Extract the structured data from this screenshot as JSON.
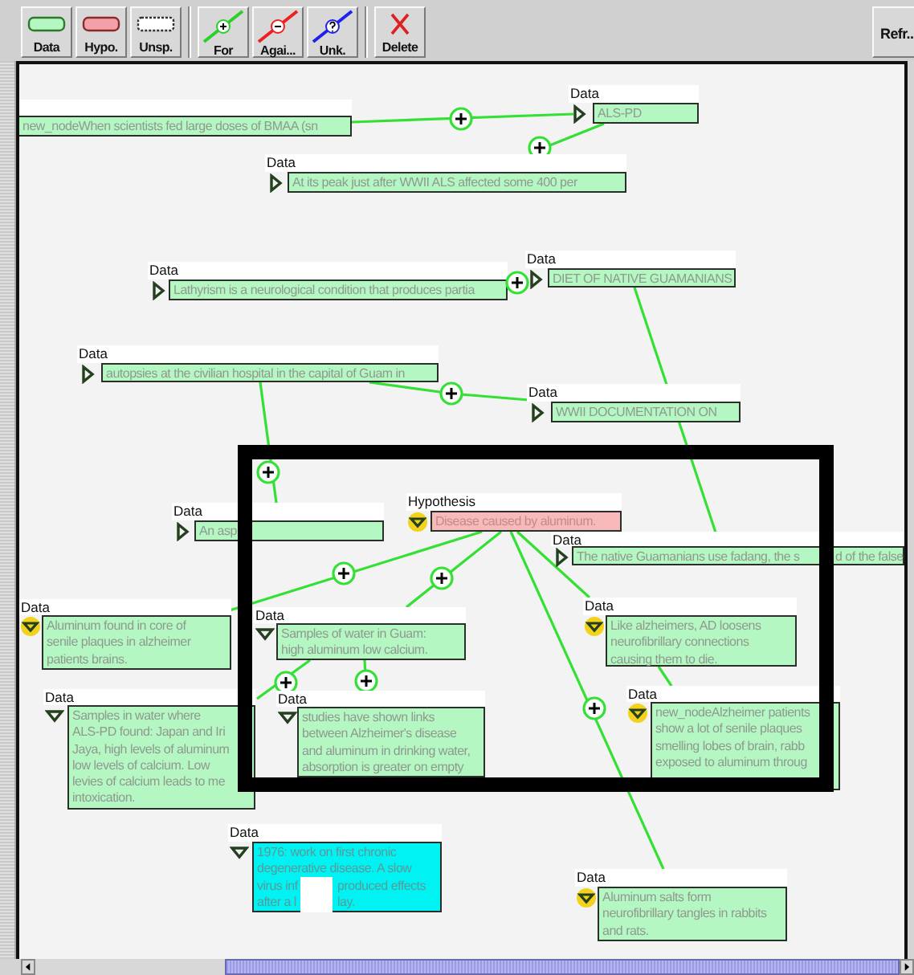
{
  "toolbar": {
    "buttons": [
      {
        "label": "Data",
        "kind": "data"
      },
      {
        "label": "Hypo.",
        "kind": "hypothesis"
      },
      {
        "label": "Unsp.",
        "kind": "unspecified"
      },
      {
        "label": "For",
        "kind": "for"
      },
      {
        "label": "Agai...",
        "kind": "against"
      },
      {
        "label": "Unk.",
        "kind": "unknown"
      },
      {
        "label": "Delete",
        "kind": "delete"
      }
    ],
    "refresh": "Refr.."
  },
  "nodes": [
    {
      "kind": "data",
      "selected": false,
      "lines": [
        "new_nodeWhen scientists fed large doses of BMAA (sn"
      ]
    },
    {
      "label": "Data",
      "kind": "data",
      "selected": false,
      "expanded": false,
      "flagged": false,
      "lines": [
        "ALS-PD"
      ]
    },
    {
      "label": "Data",
      "kind": "data",
      "selected": false,
      "expanded": false,
      "flagged": false,
      "lines": [
        "At its peak just after WWII ALS affected some 400 per"
      ]
    },
    {
      "label": "Data",
      "kind": "data",
      "selected": false,
      "expanded": false,
      "flagged": false,
      "lines": [
        "Lathyrism is a neurological condition that produces partia"
      ]
    },
    {
      "label": "Data",
      "kind": "data",
      "selected": false,
      "expanded": false,
      "flagged": false,
      "lines": [
        "DIET OF NATIVE GUAMANIANS"
      ]
    },
    {
      "label": "Data",
      "kind": "data",
      "selected": false,
      "expanded": false,
      "flagged": false,
      "lines": [
        "autopsies at the civilian hospital in the capital of Guam in"
      ]
    },
    {
      "label": "Data",
      "kind": "data",
      "selected": false,
      "expanded": false,
      "flagged": false,
      "lines": [
        "WWII DOCUMENTATION ON"
      ]
    },
    {
      "label": "Data",
      "kind": "data",
      "selected": false,
      "expanded": false,
      "flagged": false,
      "lines": [
        "An asp"
      ]
    },
    {
      "label": "Hypothesis",
      "kind": "hypothesis",
      "selected": false,
      "expanded": true,
      "flagged": true,
      "lines": [
        "Disease caused by aluminum."
      ]
    },
    {
      "label": "Data",
      "kind": "data",
      "selected": false,
      "expanded": false,
      "flagged": false,
      "lines": [
        [
          "The native Guamanians use fadang, the s",
          "d of the false"
        ]
      ]
    },
    {
      "label": "Data",
      "kind": "data",
      "selected": false,
      "expanded": true,
      "flagged": true,
      "lines": [
        "Aluminum found in core of",
        "senile plaques in alzheimer",
        "patients brains."
      ]
    },
    {
      "label": "Data",
      "kind": "data",
      "selected": false,
      "expanded": true,
      "flagged": false,
      "lines": [
        "Samples of water in Guam:",
        "high aluminum low calcium."
      ]
    },
    {
      "label": "Data",
      "kind": "data",
      "selected": false,
      "expanded": true,
      "flagged": true,
      "lines": [
        "Like alzheimers, AD loosens",
        "neurofibrillary connections",
        "causing them to die."
      ]
    },
    {
      "label": "Data",
      "kind": "data",
      "selected": false,
      "expanded": true,
      "flagged": false,
      "lines": [
        "Samples in water where",
        "ALS-PD found:  Japan and Iri",
        "Jaya, high levels of aluminum",
        "low levels of calcium.  Low",
        "levies of calcium leads to me",
        "intoxication."
      ]
    },
    {
      "label": "Data",
      "kind": "data",
      "selected": false,
      "expanded": true,
      "flagged": false,
      "lines": [
        "studies have shown links",
        "between Alzheimer's disease",
        "and aluminum in drinking water,",
        "absorption is greater on empty"
      ]
    },
    {
      "label": "Data",
      "kind": "data",
      "selected": false,
      "expanded": true,
      "flagged": true,
      "lines": [
        "new_nodeAlzheimer patients",
        "show a lot of senile plaques",
        "smelling lobes of brain, rabb",
        "exposed to aluminum throug"
      ]
    },
    {
      "label": "Data",
      "kind": "data",
      "selected": true,
      "expanded": true,
      "flagged": false,
      "lines": [
        "1976:  work on first chronic",
        "degenerative disease.  A slow",
        [
          "virus inf",
          "produced effects"
        ],
        [
          "after a l",
          "lay."
        ]
      ]
    },
    {
      "label": "Data",
      "kind": "data",
      "selected": false,
      "expanded": true,
      "flagged": true,
      "lines": [
        "Aluminum salts form",
        "neurofibrillary tangles in rabbits",
        "and rats."
      ]
    }
  ]
}
